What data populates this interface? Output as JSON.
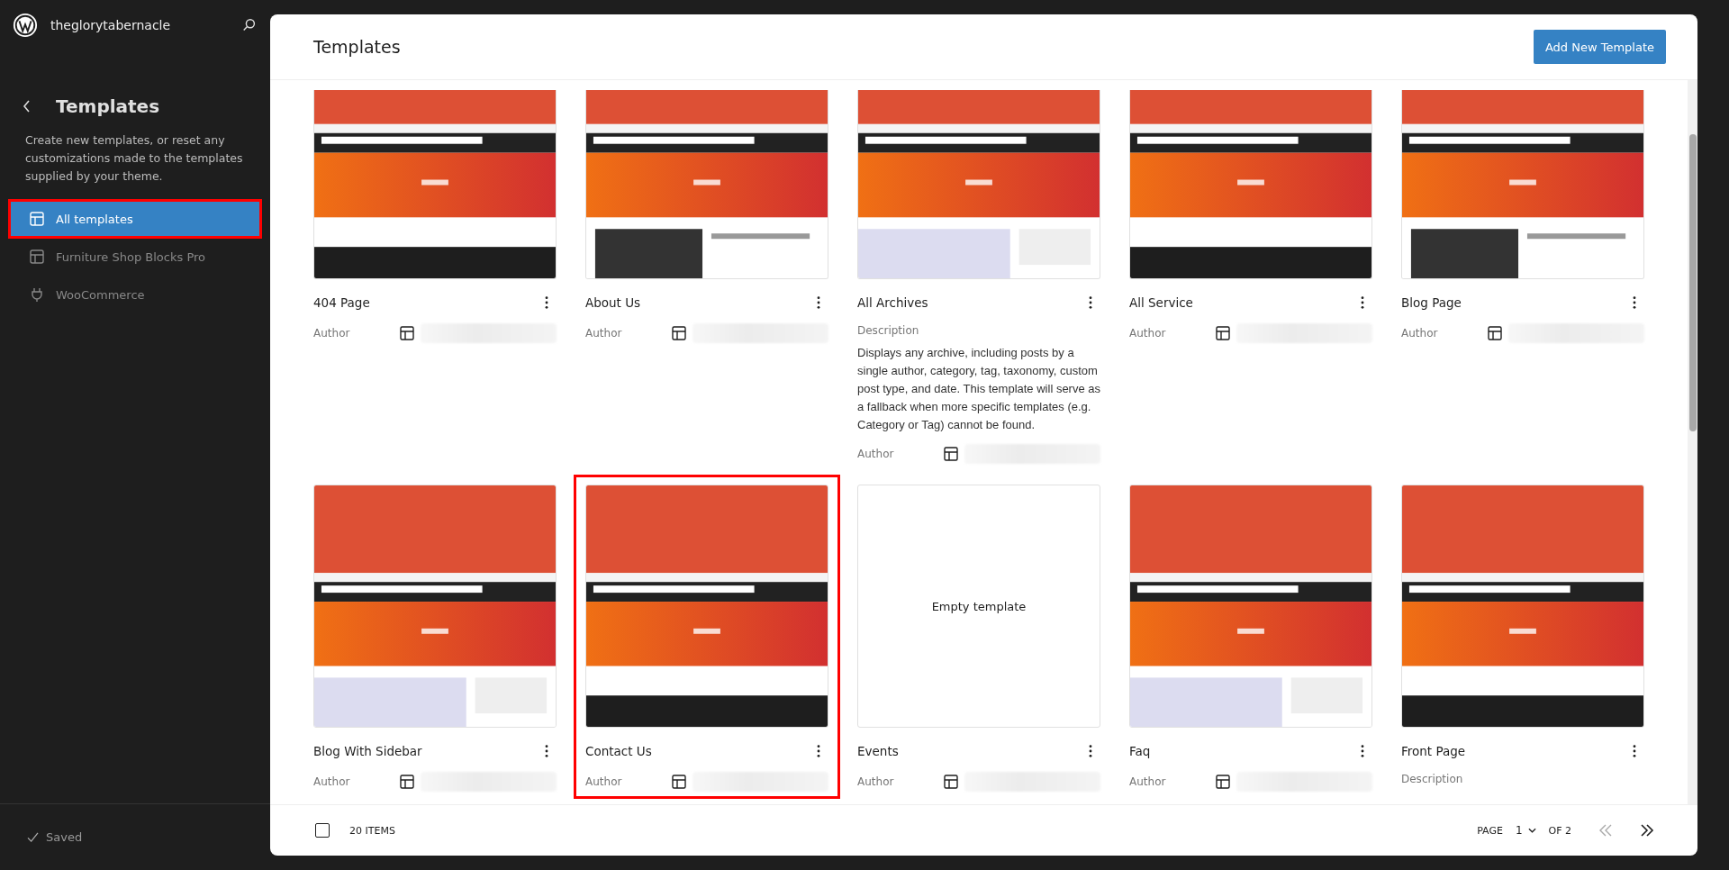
{
  "site": {
    "name": "theglorytabernacle"
  },
  "sidebar": {
    "title": "Templates",
    "description": "Create new templates, or reset any customizations made to the templates supplied by your theme.",
    "items": [
      {
        "label": "All templates",
        "kind": "layout",
        "selected": true,
        "highlighted": true
      },
      {
        "label": "Furniture Shop Blocks Pro",
        "kind": "layout",
        "selected": false,
        "highlighted": false
      },
      {
        "label": "WooCommerce",
        "kind": "plug",
        "selected": false,
        "highlighted": false
      }
    ],
    "status": "Saved"
  },
  "header": {
    "title": "Templates",
    "button": "Add New Template"
  },
  "templates": [
    {
      "title": "404 Page",
      "kind": "picture",
      "author_label": "Author",
      "highlighted": false
    },
    {
      "title": "About Us",
      "kind": "picture",
      "author_label": "Author",
      "highlighted": false
    },
    {
      "title": "All Archives",
      "kind": "picture",
      "description_label": "Description",
      "description": "Displays any archive, including posts by a single author, category, tag, taxonomy, custom post type, and date. This template will serve as a fallback when more specific templates (e.g. Category or Tag) cannot be found.",
      "author_label": "Author",
      "highlighted": false
    },
    {
      "title": "All Service",
      "kind": "picture",
      "author_label": "Author",
      "highlighted": false
    },
    {
      "title": "Blog Page",
      "kind": "picture",
      "author_label": "Author",
      "highlighted": false
    },
    {
      "title": "Blog With Sidebar",
      "kind": "picture",
      "author_label": "Author",
      "highlighted": false
    },
    {
      "title": "Contact Us",
      "kind": "picture",
      "author_label": "Author",
      "highlighted": true
    },
    {
      "title": "Events",
      "kind": "empty",
      "preview_text": "Empty template",
      "author_label": "Author",
      "highlighted": false
    },
    {
      "title": "Faq",
      "kind": "picture",
      "author_label": "Author",
      "highlighted": false
    },
    {
      "title": "Front Page",
      "kind": "picture",
      "description_label": "Description",
      "highlighted": false
    }
  ],
  "footer": {
    "count": "20 ITEMS",
    "select_all": false,
    "page_label": "PAGE",
    "page": "1",
    "of": "OF 2"
  }
}
